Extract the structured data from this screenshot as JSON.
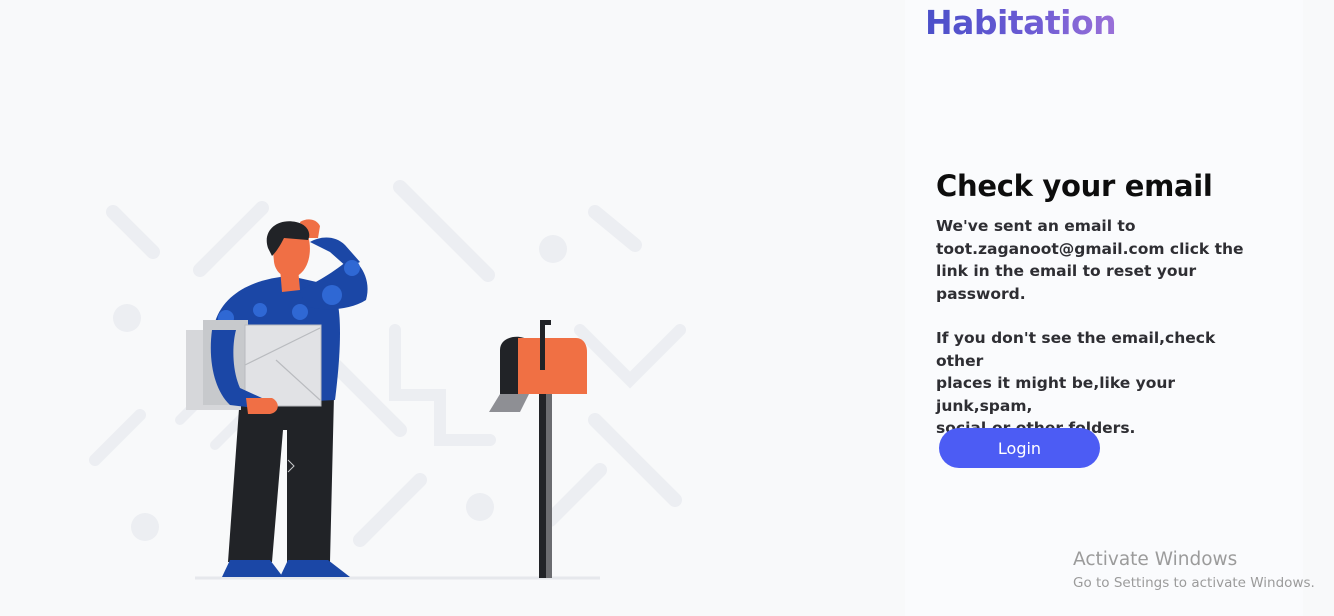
{
  "brand": {
    "name": "Habitation"
  },
  "content": {
    "title": "Check your email",
    "paragraph_1_lines": [
      "We've sent an email to",
      "toot.zaganoot@gmail.com click the",
      "link in the email to reset your",
      "password."
    ],
    "paragraph_2_lines": [
      "If you don't see the email,check other",
      "places it might be,like your junk,spam,",
      "social,or other folders."
    ],
    "login_label": "Login"
  },
  "watermark": {
    "title": "Activate Windows",
    "subtitle": "Go to Settings to activate Windows."
  },
  "colors": {
    "brand_gradient_start": "#4a4fc9",
    "brand_gradient_end": "#9a70d8",
    "button": "#4c5cf4",
    "skin": "#f06f45",
    "shirt": "#1b47a6",
    "pants": "#212327",
    "mailbox_red": "#f07044"
  },
  "illustration": {
    "icon": "person-waiting-for-mail-illustration"
  }
}
